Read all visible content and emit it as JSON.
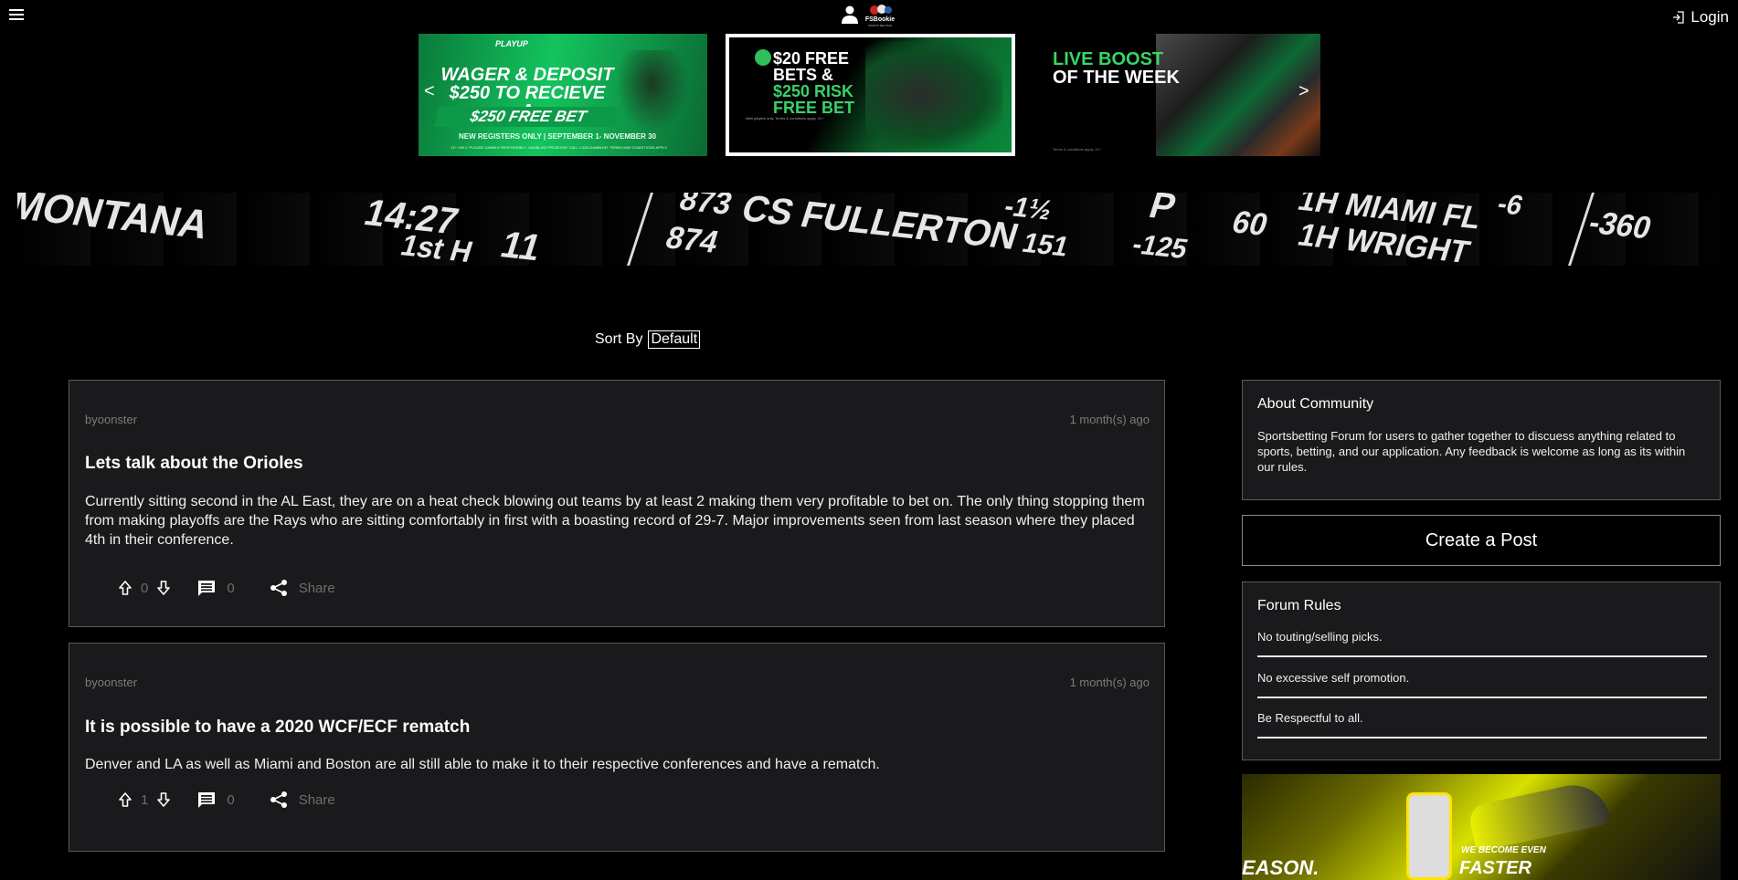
{
  "header": {
    "menu_icon": "hamburger-icon",
    "user_icon": "user-icon",
    "logo_text": "FSBookie",
    "logo_sub": "SPORTS BETTING",
    "login_label": "Login",
    "login_icon": "login-icon"
  },
  "carousel": {
    "prev": "<",
    "next": ">",
    "promos": [
      {
        "brand": "PLAYUP",
        "title": "WAGER & DEPOSIT $250 TO RECIEVE A",
        "badge": "$250 FREE BET",
        "note": "NEW REGISTERS ONLY | SEPTEMBER 1- NOVEMBER 30",
        "fine": "21+ ONLY. PLEASE GAMBLE RESPONSIBLY. GAMBLING PROBLEM? CALL 1-800-GAMBLER. TERMS AND CONDITIONS APPLY."
      },
      {
        "title_a": "$20 FREE",
        "title_b": "BETS &",
        "title_c": "$250 RISK",
        "title_d": "FREE BET",
        "fine": "New players only. Terms & conditions apply. 21+"
      },
      {
        "title_a": "LIVE BOOST",
        "title_b": "OF THE WEEK",
        "fine": "Terms & conditions apply. 21+"
      }
    ]
  },
  "banner": {
    "ticks": [
      "MONTANA",
      "14:27",
      "1st H",
      "11",
      "873",
      "874",
      "CS FULLERTON",
      "-1½",
      "151",
      "P",
      "-125",
      "60",
      "1H MIAMI FL",
      "1H WRIGHT",
      "-6",
      "-360"
    ]
  },
  "sort": {
    "label": "Sort By",
    "value": "Default"
  },
  "posts": [
    {
      "author": "byoonster",
      "time": "1 month(s) ago",
      "title": "Lets talk about the Orioles",
      "body": "Currently sitting second in the AL East, they are on a heat check blowing out teams by at least 2 making them very profitable to bet on. The only thing stopping them from making playoffs are the Rays who are sitting comfortably in first with a boasting record of 29-7. Major improvements seen from last season where they placed 4th in their conference.",
      "votes": "0",
      "comments": "0",
      "share": "Share"
    },
    {
      "author": "byoonster",
      "time": "1 month(s) ago",
      "title": "It is possible to have a 2020 WCF/ECF rematch",
      "body": "Denver and LA as well as Miami and Boston are all still able to make it to their respective conferences and have a rematch.",
      "votes": "1",
      "comments": "0",
      "share": "Share"
    }
  ],
  "sidebar": {
    "about_title": "About Community",
    "about_text": "Sportsbetting Forum for users to gather together to discuess anything related to sports, betting, and our application. Any feedback is welcome as long as its within our rules.",
    "create_label": "Create a Post",
    "rules_title": "Forum Rules",
    "rules": [
      "No touting/selling picks.",
      "No excessive self promotion.",
      "Be Respectful to all."
    ],
    "ad_left": "EASON.",
    "ad_line1": "WE BECOME EVEN",
    "ad_line2": "FASTER"
  },
  "colors": {
    "background": "#000000",
    "card": "#1a1a1c",
    "border": "#5a5a5a",
    "muted": "#7c7c7c",
    "accent_green": "#13c45e",
    "accent_yellow": "#d8e000"
  }
}
